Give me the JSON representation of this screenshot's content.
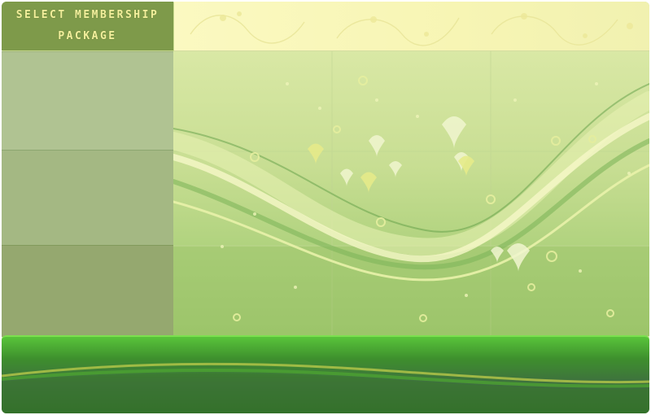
{
  "menu": {
    "title_line1": "SELECT MEMBERSHIP",
    "title_line2": "PACKAGE",
    "packages": [
      "",
      "",
      ""
    ]
  },
  "colors": {
    "title_bg": "#7e9a4a",
    "title_text": "#f3ef9c",
    "accent_green": "#59c43a"
  },
  "decor": {
    "top_strip": "yellow-floral-pattern",
    "main_art": "green-wave-hearts-background"
  }
}
